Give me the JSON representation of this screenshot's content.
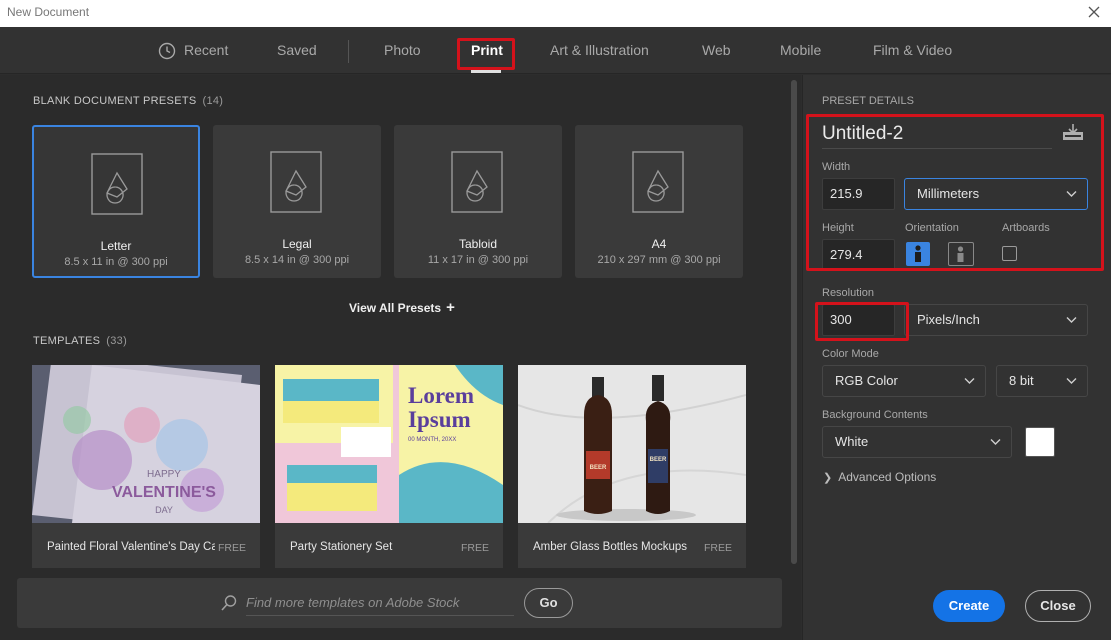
{
  "window": {
    "title": "New Document"
  },
  "tabs": [
    {
      "label": "Recent"
    },
    {
      "label": "Saved"
    },
    {
      "label": "Photo"
    },
    {
      "label": "Print",
      "active": true
    },
    {
      "label": "Art & Illustration"
    },
    {
      "label": "Web"
    },
    {
      "label": "Mobile"
    },
    {
      "label": "Film & Video"
    }
  ],
  "blank_presets": {
    "heading": "BLANK DOCUMENT PRESETS",
    "count": "(14)",
    "items": [
      {
        "name": "Letter",
        "size": "8.5 x 11 in @ 300 ppi",
        "selected": true
      },
      {
        "name": "Legal",
        "size": "8.5 x 14 in @ 300 ppi"
      },
      {
        "name": "Tabloid",
        "size": "11 x 17 in @ 300 ppi"
      },
      {
        "name": "A4",
        "size": "210 x 297 mm @ 300 ppi"
      }
    ],
    "view_all": "View All Presets",
    "view_all_icon": "+"
  },
  "templates": {
    "heading": "TEMPLATES",
    "count": "(33)",
    "items": [
      {
        "name": "Painted Floral Valentine's Day Ca...",
        "badge": "FREE",
        "thumb_text": [
          "HAPPY",
          "VALENTINE'S",
          "DAY"
        ]
      },
      {
        "name": "Party Stationery Set",
        "badge": "FREE",
        "thumb_text": [
          "Lorem",
          "Ipsum",
          "00 MONTH, 20XX"
        ]
      },
      {
        "name": "Amber Glass Bottles Mockups",
        "badge": "FREE",
        "thumb_text": [
          "BEER",
          "BEER"
        ]
      }
    ]
  },
  "stock_search": {
    "placeholder": "Find more templates on Adobe Stock",
    "go_label": "Go"
  },
  "preset_details": {
    "heading": "PRESET DETAILS",
    "document_name": "Untitled-2",
    "width_label": "Width",
    "width_value": "215.9",
    "units": "Millimeters",
    "height_label": "Height",
    "height_value": "279.4",
    "orientation_label": "Orientation",
    "artboards_label": "Artboards",
    "resolution_label": "Resolution",
    "resolution_value": "300",
    "resolution_units": "Pixels/Inch",
    "color_mode_label": "Color Mode",
    "color_mode": "RGB Color",
    "bit_depth": "8 bit",
    "background_label": "Background Contents",
    "background": "White",
    "background_swatch": "#ffffff",
    "advanced_label": "Advanced Options"
  },
  "actions": {
    "create": "Create",
    "close": "Close"
  },
  "colors": {
    "accent": "#1473e6",
    "selection": "#3a84e0",
    "highlight": "#d4121b"
  }
}
